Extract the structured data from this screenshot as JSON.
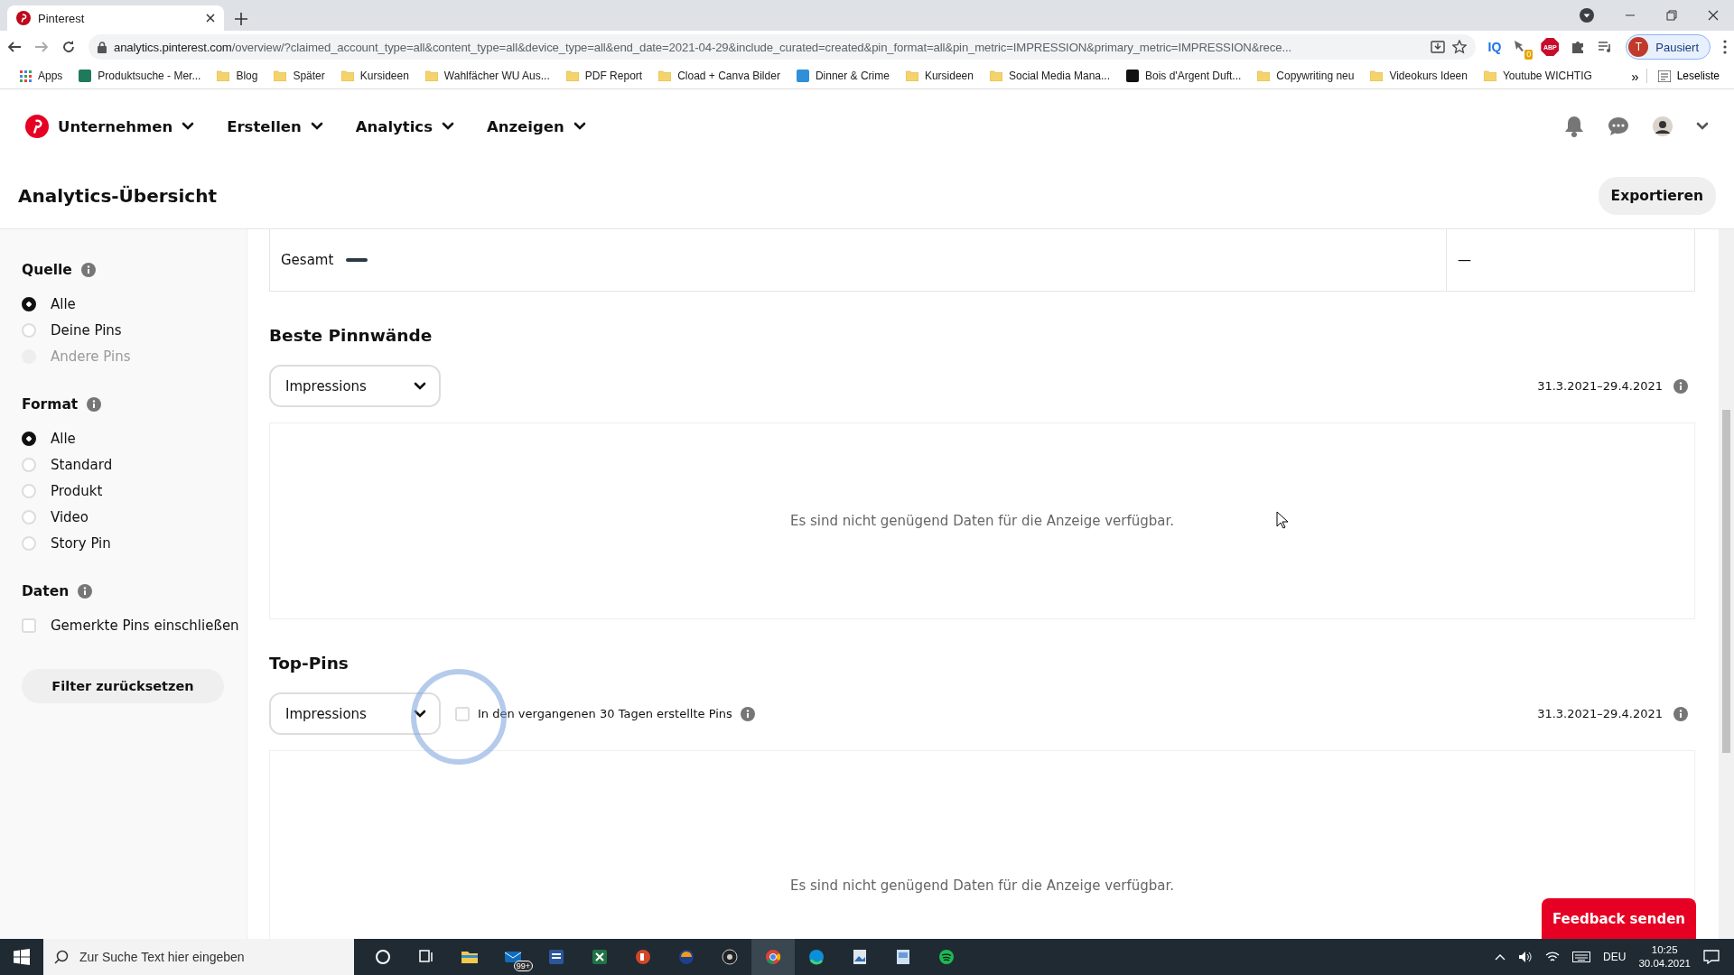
{
  "browser": {
    "tabs": [
      {
        "title": "Pinterest",
        "selected": true
      }
    ],
    "url": {
      "host": "analytics.pinterest.com",
      "path": "/overview/?claimed_account_type=all&content_type=all&device_type=all&end_date=2021-04-29&include_curated=created&pin_format=all&pin_metric=IMPRESSION&primary_metric=IMPRESSION&rece..."
    },
    "extensions": [
      {
        "kind": "text",
        "label": "IQ"
      },
      {
        "kind": "pin",
        "badge": "0"
      },
      {
        "kind": "adblock",
        "label": "ABP"
      },
      {
        "kind": "puzzle"
      },
      {
        "kind": "media"
      }
    ],
    "profile": {
      "initial": "T",
      "label": "Pausiert"
    },
    "bookmarks": [
      {
        "kind": "apps",
        "label": "Apps"
      },
      {
        "kind": "site",
        "label": "Produktsuche - Mer...",
        "color": "#1f7a5a"
      },
      {
        "kind": "folder",
        "label": "Blog"
      },
      {
        "kind": "folder",
        "label": "Später"
      },
      {
        "kind": "folder",
        "label": "Kursideen"
      },
      {
        "kind": "folder",
        "label": "Wahlfächer WU Aus..."
      },
      {
        "kind": "folder",
        "label": "PDF Report"
      },
      {
        "kind": "folder",
        "label": "Cload + Canva Bilder"
      },
      {
        "kind": "site",
        "label": "Dinner & Crime",
        "color": "#2f8fd8"
      },
      {
        "kind": "folder",
        "label": "Kursideen"
      },
      {
        "kind": "folder",
        "label": "Social Media Mana..."
      },
      {
        "kind": "site",
        "label": "Bois d'Argent Duft...",
        "color": "#111111"
      },
      {
        "kind": "folder",
        "label": "Copywriting neu"
      },
      {
        "kind": "folder",
        "label": "Videokurs Ideen"
      },
      {
        "kind": "folder",
        "label": "Youtube WICHTIG"
      }
    ],
    "bookmarks_more": "»",
    "reading_list": "Leseliste"
  },
  "nav": [
    {
      "label": "Unternehmen"
    },
    {
      "label": "Erstellen"
    },
    {
      "label": "Analytics"
    },
    {
      "label": "Anzeigen"
    }
  ],
  "page_title": "Analytics-Übersicht",
  "export_button": "Exportieren",
  "sidebar": {
    "groups": [
      {
        "title": "Quelle",
        "kind": "radio",
        "options": [
          {
            "label": "Alle",
            "selected": true,
            "disabled": false
          },
          {
            "label": "Deine Pins",
            "selected": false,
            "disabled": false
          },
          {
            "label": "Andere Pins",
            "selected": false,
            "disabled": true
          }
        ]
      },
      {
        "title": "Format",
        "kind": "radio",
        "options": [
          {
            "label": "Alle",
            "selected": true,
            "disabled": false
          },
          {
            "label": "Standard",
            "selected": false,
            "disabled": false
          },
          {
            "label": "Produkt",
            "selected": false,
            "disabled": false
          },
          {
            "label": "Video",
            "selected": false,
            "disabled": false
          },
          {
            "label": "Story Pin",
            "selected": false,
            "disabled": false
          }
        ]
      },
      {
        "title": "Daten",
        "kind": "checkbox",
        "options": [
          {
            "label": "Gemerkte Pins einschließen",
            "checked": false
          }
        ]
      }
    ],
    "reset_button": "Filter zurücksetzen"
  },
  "table": {
    "rows": [
      {
        "label": "Gesamt",
        "color": "#2b3a42",
        "value": "—"
      }
    ]
  },
  "sections": [
    {
      "title": "Beste Pinnwände",
      "dropdown": "Impressions",
      "date_range": "31.3.2021–29.4.2021",
      "empty_message": "Es sind nicht genügend Daten für die Anzeige verfügbar."
    },
    {
      "title": "Top-Pins",
      "dropdown": "Impressions",
      "filter": {
        "label": "In den vergangenen 30 Tagen erstellte Pins",
        "checked": false
      },
      "date_range": "31.3.2021–29.4.2021",
      "empty_message": "Es sind nicht genügend Daten für die Anzeige verfügbar."
    }
  ],
  "feedback_button": "Feedback senden",
  "taskbar": {
    "search_placeholder": "Zur Suche Text hier eingeben",
    "mail_badge": "99+",
    "language": "DEU",
    "time": "10:25",
    "date": "30.04.2021"
  }
}
